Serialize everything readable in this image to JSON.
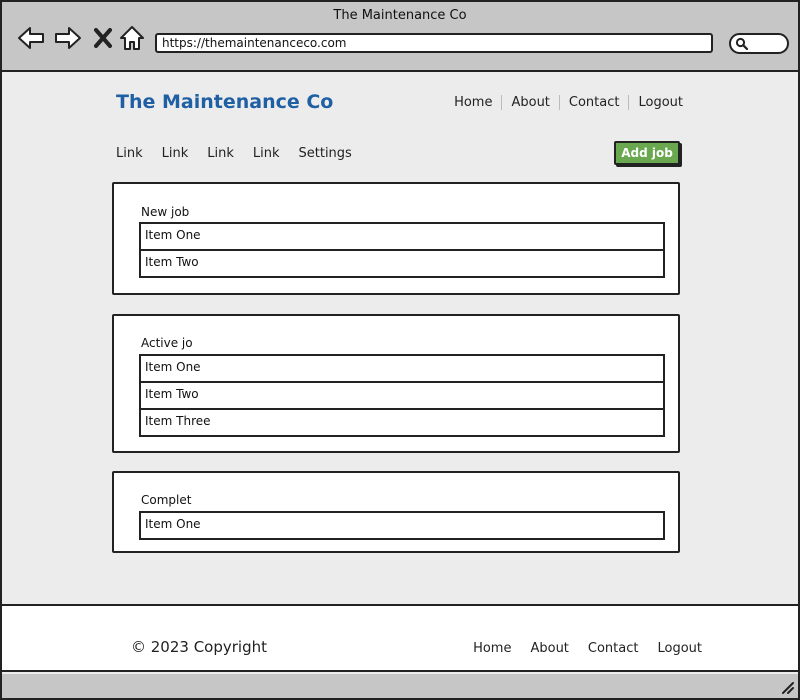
{
  "window": {
    "title": "The Maintenance Co"
  },
  "browser": {
    "url": "https://themaintenanceco.com",
    "icons": [
      "back-arrow-icon",
      "forward-arrow-icon",
      "close-x-icon",
      "home-icon",
      "search-icon"
    ]
  },
  "header": {
    "brand": "The Maintenance Co",
    "nav": [
      "Home",
      "About",
      "Contact",
      "Logout"
    ]
  },
  "subnav": {
    "links": [
      "Link",
      "Link",
      "Link",
      "Link",
      "Settings"
    ],
    "add_button": "Add job"
  },
  "panels": [
    {
      "title": "New job",
      "items": [
        "Item One",
        "Item Two"
      ]
    },
    {
      "title": "Active jo",
      "items": [
        "Item One",
        "Item Two",
        "Item Three"
      ]
    },
    {
      "title": "Complet",
      "items": [
        "Item One"
      ]
    }
  ],
  "footer": {
    "copyright": "© 2023 Copyright",
    "nav": [
      "Home",
      "About",
      "Contact",
      "Logout"
    ]
  },
  "colors": {
    "brand": "#1f5fa4",
    "accent_button": "#6aa84f",
    "chrome": "#c6c6c6",
    "page_bg": "#ececec"
  }
}
